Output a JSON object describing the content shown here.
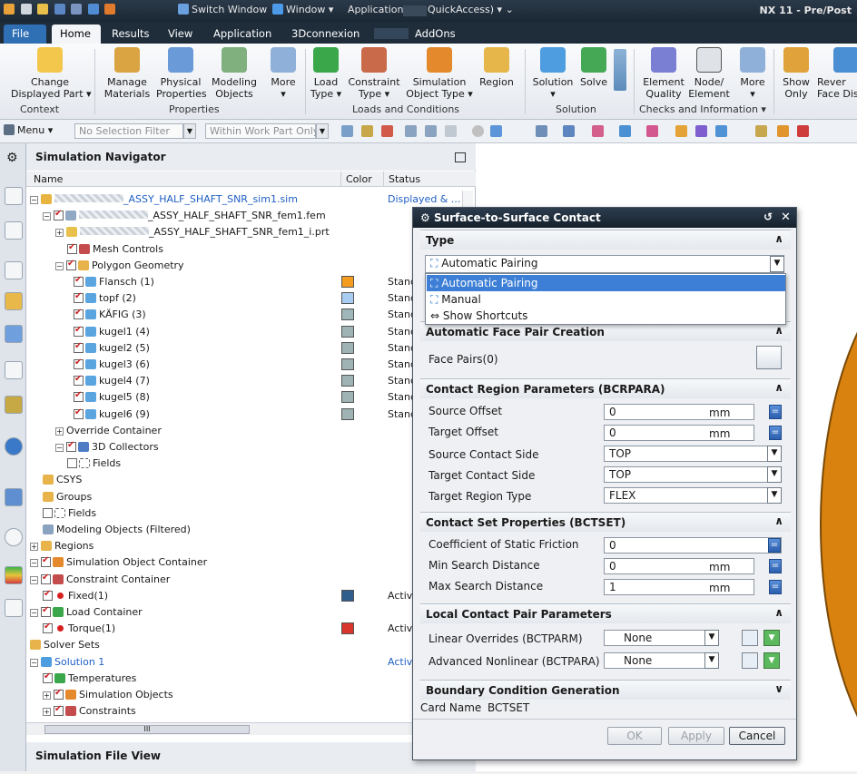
{
  "titlebar": {
    "items": [
      "Switch Window",
      "Window ▾",
      "Application (",
      "QuickAccess) ▾ ⌄"
    ],
    "title": "NX 11 - Pre/Post"
  },
  "tabs": [
    {
      "label": "File"
    },
    {
      "label": "Home"
    },
    {
      "label": "Results"
    },
    {
      "label": "View"
    },
    {
      "label": "Application"
    },
    {
      "label": "3Dconnexion"
    },
    {
      "label": "AddOns"
    }
  ],
  "ribbon": {
    "buttons": [
      {
        "label": "Change\nDisplayed Part ▾"
      },
      {
        "label": "Manage\nMaterials"
      },
      {
        "label": "Physical\nProperties"
      },
      {
        "label": "Modeling\nObjects"
      },
      {
        "label": "More\n▾"
      },
      {
        "label": "Load\nType ▾"
      },
      {
        "label": "Constraint\nType ▾"
      },
      {
        "label": "Simulation\nObject Type ▾"
      },
      {
        "label": "Region"
      },
      {
        "label": "Solution\n▾"
      },
      {
        "label": "Solve"
      },
      {
        "label": "Element\nQuality"
      },
      {
        "label": "Node/\nElement"
      },
      {
        "label": "More\n▾"
      },
      {
        "label": "Show\nOnly"
      },
      {
        "label": "Rever\nFace Dis"
      }
    ],
    "groups": [
      "Context",
      "Properties",
      "Loads and Conditions",
      "Solution",
      "Checks and Information ▾"
    ]
  },
  "selbar": {
    "menu": "Menu ▾",
    "filter": "No Selection Filter",
    "scope": "Within Work Part Only"
  },
  "nav": {
    "title": "Simulation Navigator",
    "columns": [
      "Name",
      "Color",
      "Status"
    ],
    "rows": [
      {
        "name": "_ASSY_HALF_SHAFT_SNR_sim1.sim",
        "status": "Displayed & ..."
      },
      {
        "name": "_ASSY_HALF_SHAFT_SNR_fem1.fem",
        "status": ""
      },
      {
        "name": "_ASSY_HALF_SHAFT_SNR_fem1_i.prt",
        "status": ""
      },
      {
        "name": "Mesh Controls",
        "status": ""
      },
      {
        "name": "Polygon Geometry",
        "status": ""
      },
      {
        "name": "Flansch (1)",
        "status": "Stand"
      },
      {
        "name": "topf (2)",
        "status": "Stand"
      },
      {
        "name": "KÄFIG (3)",
        "status": "Stand"
      },
      {
        "name": "kugel1 (4)",
        "status": "Stand"
      },
      {
        "name": "kugel2 (5)",
        "status": "Stand"
      },
      {
        "name": "kugel3 (6)",
        "status": "Stand"
      },
      {
        "name": "kugel4 (7)",
        "status": "Stand"
      },
      {
        "name": "kugel5 (8)",
        "status": "Stand"
      },
      {
        "name": "kugel6 (9)",
        "status": "Stand"
      },
      {
        "name": "Override Container",
        "status": ""
      },
      {
        "name": "3D Collectors",
        "status": ""
      },
      {
        "name": "Fields",
        "status": ""
      },
      {
        "name": "CSYS",
        "status": ""
      },
      {
        "name": "Groups",
        "status": ""
      },
      {
        "name": "Fields",
        "status": ""
      },
      {
        "name": "Modeling Objects (Filtered)",
        "status": ""
      },
      {
        "name": "Regions",
        "status": ""
      },
      {
        "name": "Simulation Object Container",
        "status": ""
      },
      {
        "name": "Constraint Container",
        "status": ""
      },
      {
        "name": "Fixed(1)",
        "status": "Activ"
      },
      {
        "name": "Load Container",
        "status": ""
      },
      {
        "name": "Torque(1)",
        "status": "Activ"
      },
      {
        "name": "Solver Sets",
        "status": ""
      },
      {
        "name": "Solution 1",
        "status": "Activ"
      },
      {
        "name": "Temperatures",
        "status": ""
      },
      {
        "name": "Simulation Objects",
        "status": ""
      },
      {
        "name": "Constraints",
        "status": ""
      }
    ],
    "swatches": {
      "Flansch (1)": "#f39c1e",
      "topf (2)": "#a9cdf2",
      "KÄFIG (3)": "#9fb7b8",
      "kugel": "#9fb3b4",
      "Fixed(1)": "#2f5d8c",
      "Torque(1)": "#d9352c"
    },
    "scroll_label": "III",
    "file_view_title": "Simulation File View"
  },
  "dialog": {
    "title": "Surface-to-Surface Contact",
    "type_section": "Type",
    "type_value": "Automatic Pairing",
    "dropdown_options": [
      "Automatic Pairing",
      "Manual",
      "Show Shortcuts"
    ],
    "auto_section": "Automatic Face Pair Creation",
    "face_pairs": "Face Pairs(0)",
    "bcrpara_section": "Contact Region Parameters (BCRPARA)",
    "source_offset": {
      "label": "Source Offset",
      "value": "0",
      "unit": "mm"
    },
    "target_offset": {
      "label": "Target Offset",
      "value": "0",
      "unit": "mm"
    },
    "source_side": {
      "label": "Source Contact Side",
      "value": "TOP"
    },
    "target_side": {
      "label": "Target Contact Side",
      "value": "TOP"
    },
    "target_region": {
      "label": "Target Region Type",
      "value": "FLEX"
    },
    "bctset_section": "Contact Set Properties (BCTSET)",
    "friction": {
      "label": "Coefficient of Static Friction",
      "value": "0"
    },
    "min_search": {
      "label": "Min Search Distance",
      "value": "0",
      "unit": "mm"
    },
    "max_search": {
      "label": "Max Search Distance",
      "value": "1",
      "unit": "mm"
    },
    "local_section": "Local Contact Pair Parameters",
    "linear_overrides": {
      "label": "Linear Overrides (BCTPARM)",
      "value": "None"
    },
    "adv_nonlinear": {
      "label": "Advanced Nonlinear (BCTPARA)",
      "value": "None"
    },
    "bc_section": "Boundary Condition Generation",
    "card_name_label": "Card Name",
    "card_name_value": "BCTSET",
    "ok": "OK",
    "apply": "Apply",
    "cancel": "Cancel"
  }
}
